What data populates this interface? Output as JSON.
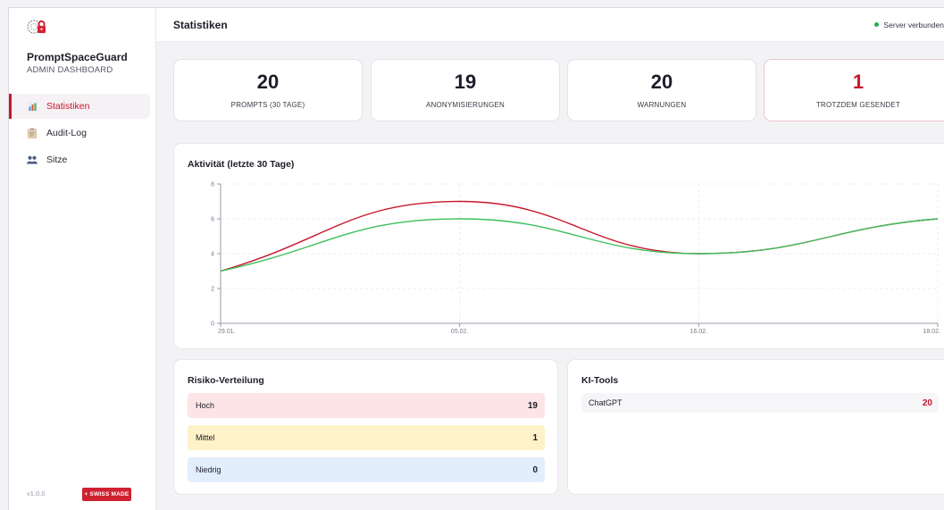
{
  "brand": {
    "name": "PromptSpaceGuard",
    "subtitle": "ADMIN DASHBOARD"
  },
  "sidebar": {
    "items": [
      {
        "label": "Statistiken",
        "icon": "bar-chart-icon",
        "active": true
      },
      {
        "label": "Audit-Log",
        "icon": "clipboard-icon",
        "active": false
      },
      {
        "label": "Sitze",
        "icon": "users-icon",
        "active": false
      }
    ],
    "version": "v1.0.0",
    "badge": "+ SWISS MADE"
  },
  "header": {
    "title": "Statistiken",
    "status": "Server verbunden",
    "status_color": "#23b04c"
  },
  "stats": [
    {
      "value": "20",
      "label": "PROMPTS (30 TAGE)"
    },
    {
      "value": "19",
      "label": "ANONYMISIERUNGEN"
    },
    {
      "value": "20",
      "label": "WARNUNGEN"
    },
    {
      "value": "1",
      "label": "TROTZDEM GESENDET"
    }
  ],
  "activity": {
    "title": "Aktivität (letzte 30 Tage)"
  },
  "chart_data": {
    "type": "line",
    "x": [
      "29.01.",
      "05.02.",
      "16.02.",
      "18.02."
    ],
    "series": [
      {
        "values": [
          3,
          7,
          4,
          6
        ],
        "color": "#c8172f"
      },
      {
        "values": [
          3,
          6,
          4,
          6
        ],
        "color": "#3dbf5a"
      }
    ],
    "yticks": [
      0,
      2,
      4,
      6,
      8
    ],
    "ylim": [
      0,
      8
    ],
    "grid": true
  },
  "risk": {
    "title": "Risiko-Verteilung",
    "rows": [
      {
        "label": "Hoch",
        "value": "19",
        "bg": "#fde4e6"
      },
      {
        "label": "Mittel",
        "value": "1",
        "bg": "#fdf2c8"
      },
      {
        "label": "Niedrig",
        "value": "0",
        "bg": "#e2eefb"
      }
    ]
  },
  "tools": {
    "title": "KI-Tools",
    "rows": [
      {
        "label": "ChatGPT",
        "value": "20"
      }
    ]
  },
  "colors": {
    "accent": "#c8172f",
    "success": "#23b04c"
  }
}
